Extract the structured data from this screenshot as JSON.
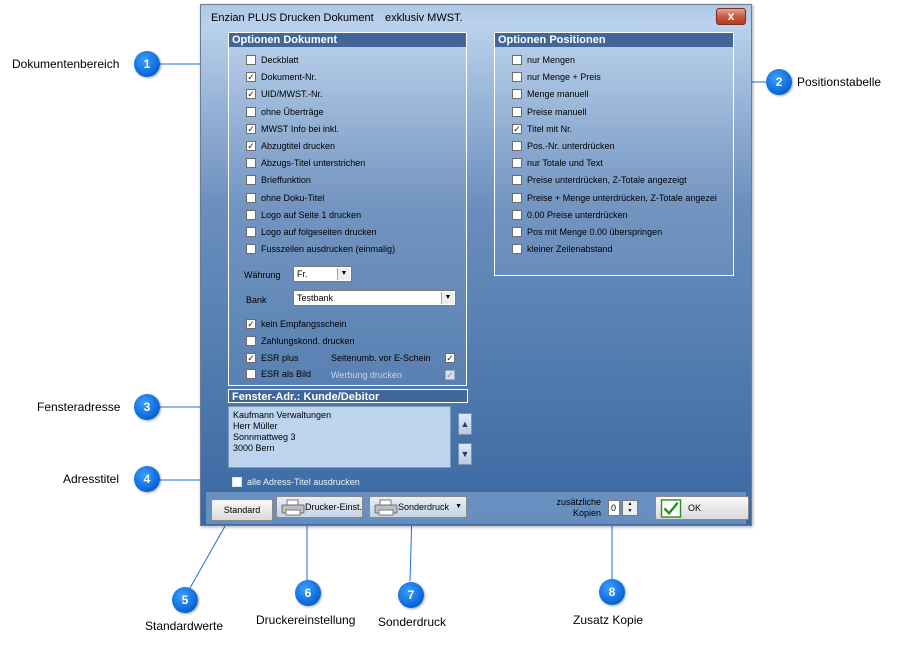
{
  "window": {
    "title": "Enzian PLUS Drucken Dokument",
    "title_extra": "exklusiv MWST.",
    "close_symbol": "x"
  },
  "options_document": {
    "header": "Optionen Dokument",
    "items": [
      {
        "label": "Deckblatt",
        "checked": false
      },
      {
        "label": "Dokument-Nr.",
        "checked": true
      },
      {
        "label": "UID/MWST.-Nr.",
        "checked": true
      },
      {
        "label": "ohne Überträge",
        "checked": false
      },
      {
        "label": "MWST Info bei inkl.",
        "checked": true
      },
      {
        "label": "Abzugtitel drucken",
        "checked": true
      },
      {
        "label": "Abzugs-Titel unterstrichen",
        "checked": false
      },
      {
        "label": "Brieffunktion",
        "checked": false
      },
      {
        "label": "ohne Doku-Titel",
        "checked": false
      },
      {
        "label": "Logo auf Seite 1 drucken",
        "checked": false
      },
      {
        "label": "Logo auf folgeseiten drucken",
        "checked": false
      },
      {
        "label": "Fusszeilen ausdrucken (einmalig)",
        "checked": false
      }
    ],
    "currency_label": "Währung",
    "currency_value": "Fr.",
    "bank_label": "Bank",
    "bank_value": "Testbank",
    "lower_items": [
      {
        "label": "kein Empfangsschein",
        "checked": true
      },
      {
        "label": "Zahlungskond. drucken",
        "checked": false
      },
      {
        "label": "ESR plus",
        "checked": true
      },
      {
        "label": "ESR als Bild",
        "checked": false
      }
    ],
    "right_items": [
      {
        "label": "Seitenumb. vor E-Schein",
        "checked": true,
        "disabled": false
      },
      {
        "label": "Werbung drucken",
        "checked": true,
        "disabled": true
      }
    ]
  },
  "options_positions": {
    "header": "Optionen Positionen",
    "items": [
      {
        "label": "nur Mengen",
        "checked": false
      },
      {
        "label": "nur Menge + Preis",
        "checked": false
      },
      {
        "label": "Menge manuell",
        "checked": false
      },
      {
        "label": "Preise manuell",
        "checked": false
      },
      {
        "label": "Titel mit Nr.",
        "checked": true
      },
      {
        "label": "Pos.-Nr. unterdrücken",
        "checked": false
      },
      {
        "label": "nur Totale und Text",
        "checked": false
      },
      {
        "label": "Preise unterdrücken, Z-Totale angezeigt",
        "checked": false
      },
      {
        "label": "Preise + Menge unterdrücken, Z-Totale angezei",
        "checked": false
      },
      {
        "label": "0.00 Preise unterdrücken",
        "checked": false
      },
      {
        "label": "Pos mit Menge 0.00 überspringen",
        "checked": false
      },
      {
        "label": "kleiner Zeilenabstand",
        "checked": false
      }
    ]
  },
  "window_address": {
    "header": "Fenster-Adr.: Kunde/Debitor",
    "lines": [
      "Kaufmann Verwaltungen",
      "Herr Müller",
      "Sonnmattweg 3",
      "3000 Bern"
    ],
    "print_all_titles_label": "alle Adress-Titel ausdrucken",
    "print_all_titles_checked": false
  },
  "footer": {
    "standard_label": "Standard",
    "printer_settings_label": "Drucker-Einst.",
    "special_print_label": "Sonderdruck",
    "extra_copies_label_1": "zusätzliche",
    "extra_copies_label_2": "Kopien",
    "extra_copies_value": "0",
    "ok_label": "OK"
  },
  "callouts": [
    {
      "num": "1",
      "label": "Dokumentenbereich"
    },
    {
      "num": "2",
      "label": "Positionstabelle"
    },
    {
      "num": "3",
      "label": "Fensteradresse"
    },
    {
      "num": "4",
      "label": "Adresstitel"
    },
    {
      "num": "5",
      "label": "Standardwerte"
    },
    {
      "num": "6",
      "label": "Druckereinstellung"
    },
    {
      "num": "7",
      "label": "Sonderdruck"
    },
    {
      "num": "8",
      "label": "Zusatz Kopie"
    }
  ],
  "colors": {
    "group_header": "#43669a",
    "badge": "#0863d6",
    "callout_line": "#1e6fd8"
  }
}
